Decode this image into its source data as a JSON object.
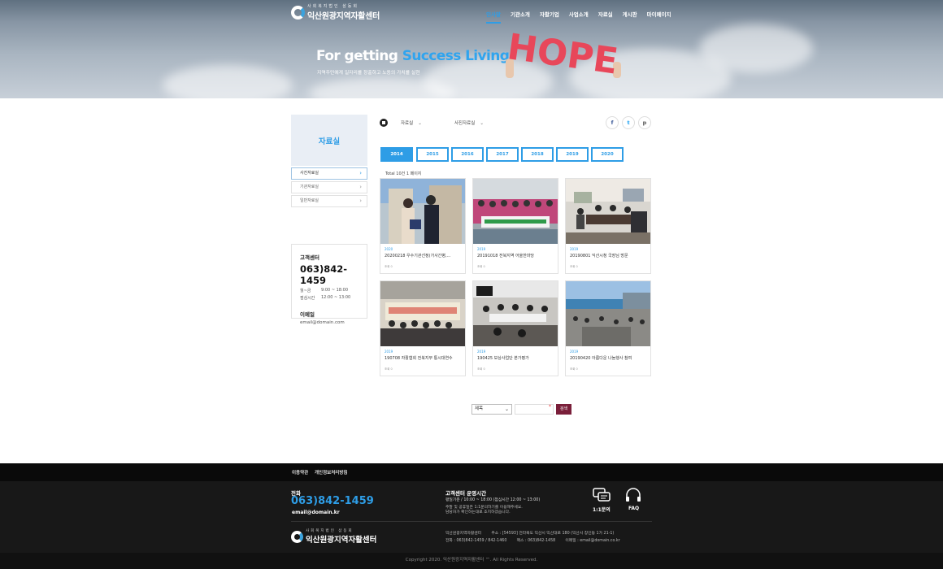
{
  "header": {
    "logo_small": "사회복지법인 삼동회",
    "logo_big": "익산원광지역자활센터",
    "nav": [
      "인사말",
      "기관소개",
      "자활기업",
      "사업소개",
      "자료실",
      "게시판",
      "마이페이지"
    ],
    "nav_active_index": 0
  },
  "hero": {
    "slogan_white": "For getting ",
    "slogan_blue": "Success Living",
    "subtitle": "지역주민에게 일자리를 창출하고 노동의 가치를 실현",
    "hope_text": "HOPE"
  },
  "sidebar": {
    "title": "자료실",
    "items": [
      {
        "label": "사진자료실",
        "active": true
      },
      {
        "label": "기관자료실",
        "active": false
      },
      {
        "label": "일반자료실",
        "active": false
      }
    ],
    "cs_title": "고객센터",
    "cs_tel": "063)842-1459",
    "hours": [
      {
        "k": "월~금",
        "v": "9:00 ~ 18:00"
      },
      {
        "k": "점심시간",
        "v": "12:00 ~ 13:00"
      }
    ],
    "email_title": "이메일",
    "email": "email@domain.com"
  },
  "breadcrumb": {
    "level1": "자료실",
    "level2": "사진자료실"
  },
  "share": {
    "facebook": "f",
    "twitter": "t",
    "print": "p"
  },
  "year_tabs": [
    "2014",
    "2015",
    "2016",
    "2017",
    "2018",
    "2019",
    "2020"
  ],
  "year_active_index": 0,
  "total_text": "Total 10건 1 페이지",
  "gallery": [
    {
      "year": "2020",
      "title": "20200218 우수기관선정(가사간병,...",
      "views": "조회 0"
    },
    {
      "year": "2019",
      "title": "20191018 전북지역 어울한마당",
      "views": "조회 0"
    },
    {
      "year": "2019",
      "title": "20190801 익산시청 국장님 방문",
      "views": "조회 0"
    },
    {
      "year": "2019",
      "title": "190708 자활협회 전북지부 통시대연수",
      "views": "조회 0"
    },
    {
      "year": "2019",
      "title": "190425 보상사업단 본가평가",
      "views": "조회 0"
    },
    {
      "year": "2019",
      "title": "20190420 아름다운 나눔행사 참여",
      "views": "조회 0"
    }
  ],
  "search": {
    "field_selected": "제목",
    "button": "검색"
  },
  "footer": {
    "links": [
      "이용약관",
      "개인정보처리방침"
    ],
    "tel_label": "전화",
    "tel": "063)842-1459",
    "email": "email@domain.kr",
    "hours_title": "고객센터 운영시간",
    "hours_line": "평일기준 / 10:00 ~ 18:00 (점심시간 12:00 ~ 13:00)",
    "notice_1": "주말 및 공휴일은 1:1문의하기를 이용해주세요.",
    "notice_2": "담당자가 확인하는대로 조치하겠습니다.",
    "qna_label": "1:1문의",
    "faq_label": "FAQ",
    "logo_small": "사회복지법인 삼동회",
    "logo_big": "익산원광지역자활센터",
    "info_line1": "익산원광지역자활센터        주소 : [54593] 전라북도 익산시 익산대로 180 (익산시 창인동 1가 21-1)",
    "info_line2": "전화 : 063)842-1459 / 842-1460        팩스 : 063)842-1458        이메일 : email@domain.co.kr",
    "copyright": "Copyright 2020. 익산원광지역자활센터 ™. All Rights Reserved."
  }
}
